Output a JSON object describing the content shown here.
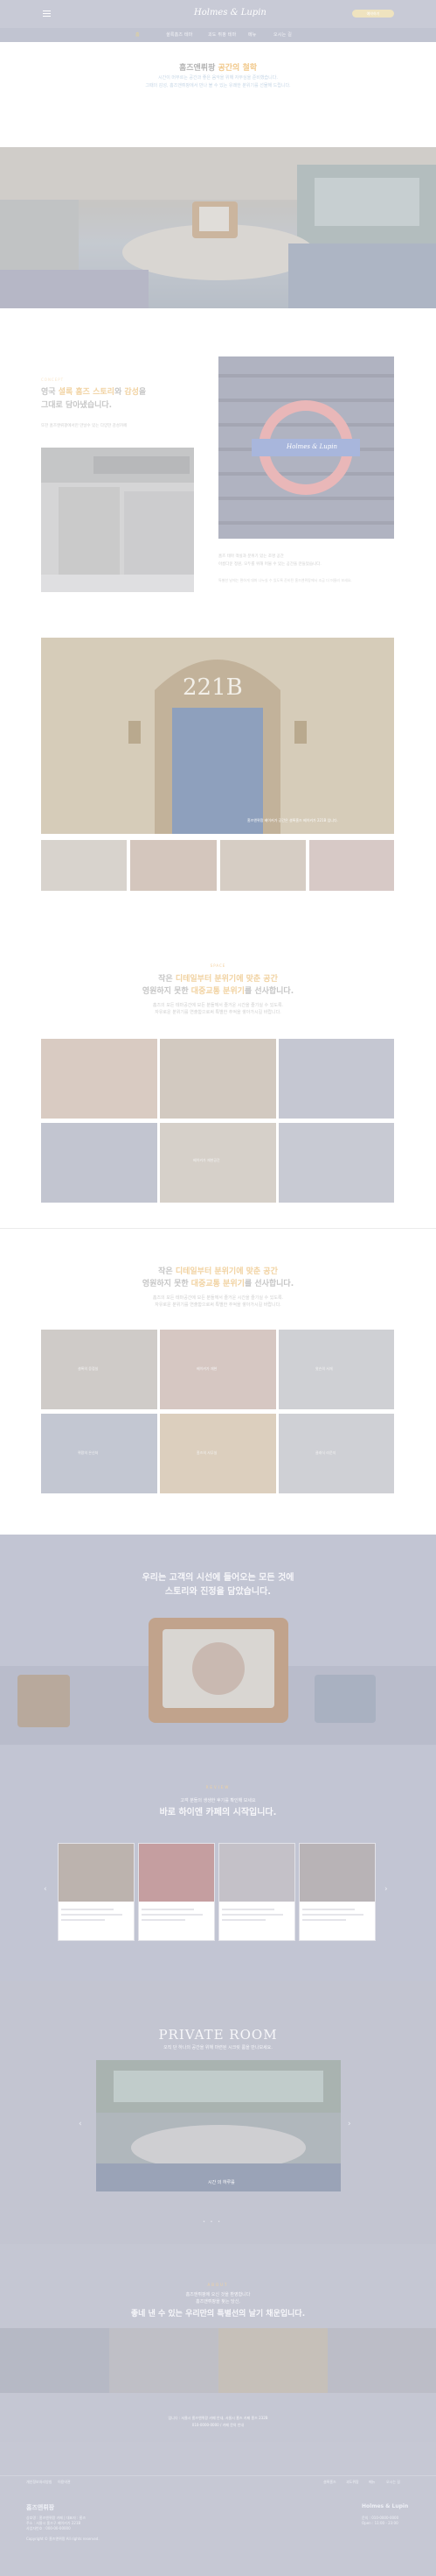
{
  "header": {
    "logo": "Holmes & Lupin",
    "cta": "예약하기",
    "nav": [
      "홈",
      "셜록홈즈 테마",
      "괴도 뤼팡 테마",
      "메뉴",
      "오시는 길"
    ]
  },
  "intro": {
    "title_a": "홈즈앤뤼팡 ",
    "title_b": "공간의 철학",
    "sub1": "시간이 머무르는 공간과 좋은 음악을 위해 자부심을 준비했습니다.",
    "sub2": "그때의 감성, 홈즈앤뤼팡에서 만나 볼 수 있는 유쾌한 분위기를 선물해 드립니다."
  },
  "concept": {
    "eyebrow": "CONCEPT",
    "title_l1_a": "영국 ",
    "title_l1_b": "셜록 홈즈 스토리",
    "title_l1_c": "와 ",
    "title_l1_d": "감성",
    "title_l1_e": "을",
    "title_l2": "그대로 담아냈습니다.",
    "body": "또한 홈즈앤뤼팡에서만 만날수 있는 다양한 감성카페",
    "side1": "홈즈 테마 객실과 분위기 있는 조명 공간",
    "side2": "아름다운 정원, 모두를 위해 머물 수 있는 공간을 만들었습니다.",
    "side3": "특별한 날에는 편하게 대화 나누실 수 있도록 준비된 홈즈앤뤼팡에서 조금 더 머물러 보세요.",
    "sign_logo": "Holmes & Lupin"
  },
  "door": {
    "number": "221B",
    "caption": "홈즈앤뤼팡 베이커가 공간은 셜록홈즈 베이커가 221B 입니다."
  },
  "section3": {
    "eyebrow": "SPACE",
    "t1_a": "작은 ",
    "t1_b": "디테일부터 분위기에 맞춘 공간",
    "t2_a": "영원하지 못한 ",
    "t2_b": "대중교통 분위기",
    "t2_c": "를 ",
    "t2_d": "선사합니다.",
    "s1": "홈즈의 모든 테마공간에 모든 분들께서 즐거운 시간을 즐기실 수 있도록.",
    "s2": "자유로운 분위기를 연출함으로써 특별한 추억을 쌓아가시길 바랍니다.",
    "tile_caption": "베이커가 재현공간"
  },
  "section4": {
    "t1_a": "작은 ",
    "t1_b": "디테일부터 분위기에 맞춘 공간",
    "t2_a": "영원하지 못한 ",
    "t2_b": "대중교통 분위기",
    "t2_c": "를 ",
    "t2_d": "선사합니다.",
    "s1": "홈즈의 모든 테마공간에 모든 분들께서 즐거운 시간을 즐기실 수 있도록.",
    "s2": "자유로운 분위기를 연출함으로써 특별한 추억을 쌓아가시길 바랍니다.",
    "tiles": [
      "셜록의 응접실",
      "베이커가 재현",
      "왓슨의 서재",
      "뤼팡의 은신처",
      "홈즈의 사무실",
      "클래식 라운지"
    ]
  },
  "story": {
    "l1": "우리는 고객의 시선에 들어오는 모든 것에",
    "l2": "스토리와 진정을 담았습니다."
  },
  "review": {
    "eyebrow": "REVIEW",
    "l1": "고객 분들의 생생한 후기를 확인해 보세요",
    "l2": "바로 하이엔 카페의 시작입니다."
  },
  "private": {
    "title": "PRIVATE ROOM",
    "sub": "오직 단 하나의 공간을 위해 마련된 시크릿 룸을 만나보세요.",
    "caption": "시간 의 하루를"
  },
  "closing": {
    "eyebrow": "ABOUT",
    "l1": "홈즈앤뤼팡에 오신 것을 환영합니다",
    "l2": "홈즈앤뤼팡을 찾는 당신,",
    "l3": "좋네 낸 수 있는 우리만의 특별선의 날기 채운입니다.",
    "contact1": "입니다 : 서울시 홈즈앤뤼팡 카페 안내, 서울시 홈즈 카페 홈즈 232B",
    "contact2": "010-0000-0000 / 카페 문의 안내"
  },
  "footer": {
    "links_left": [
      "개인정보처리방침",
      "이용약관"
    ],
    "links_right": [
      "셜록홈즈",
      "괴도뤼팡",
      "메뉴",
      "오시는 길"
    ],
    "brand": "홈즈앤뤼팡",
    "addr1": "상호명 : 홈즈앤뤼팡 카페 | 대표자 : 홈즈",
    "addr2": "주소 : 서울시 홈즈구 베이커가 221B",
    "addr3": "사업자번호 : 000-00-00000",
    "copyright": "Copyright © 홈즈앤뤼팡 All rights reserved.",
    "right_title": "Holmes & Lupin",
    "right1": "문의 : 010-0000-0000",
    "right2": "Open : 11:00 - 23:00"
  },
  "colors": {
    "accent": "#f1c88a",
    "header": "#c8cad6",
    "band": "#c2c5d3",
    "cta": "#efe3bf"
  }
}
